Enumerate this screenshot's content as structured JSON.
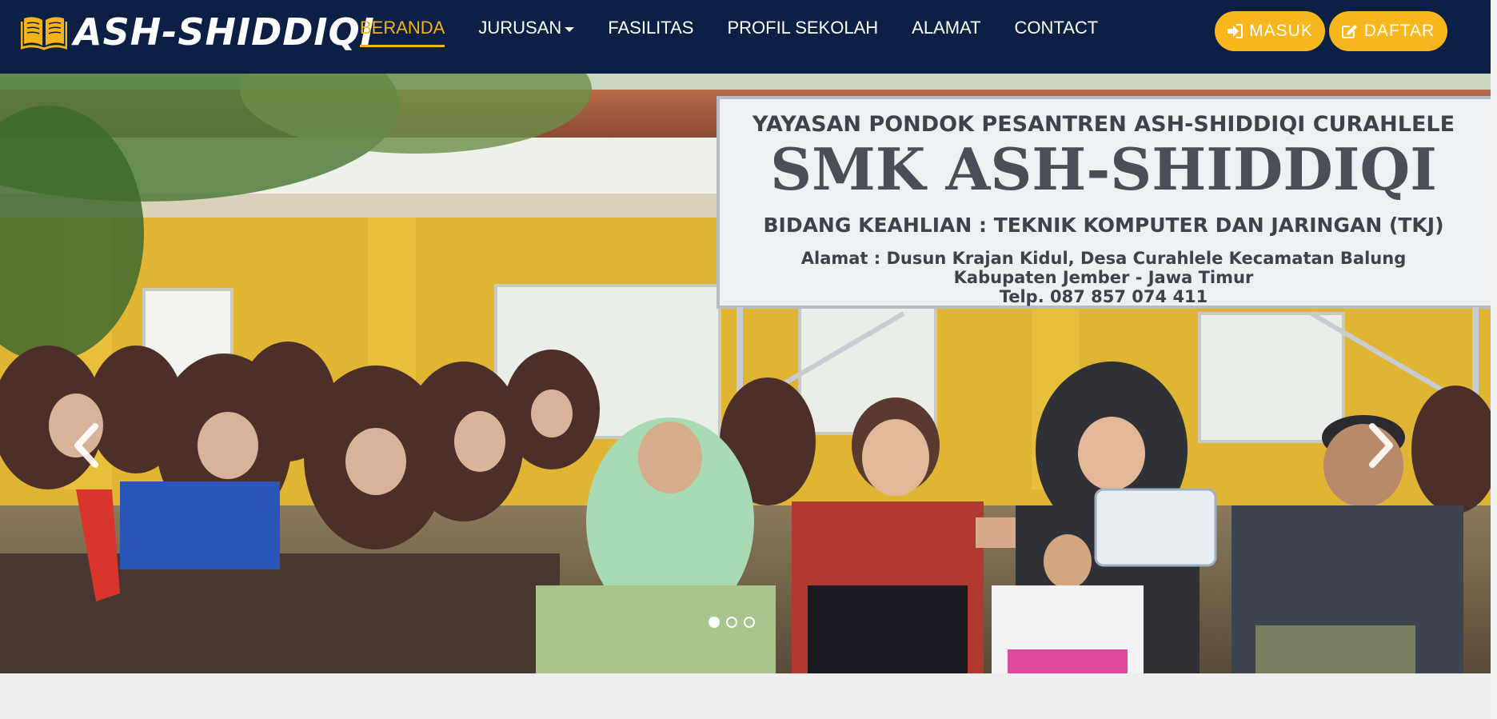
{
  "brand": {
    "name": "ASH-SHIDDIQI",
    "icon": "book-open-icon"
  },
  "nav": {
    "items": [
      {
        "label": "BERANDA",
        "active": true
      },
      {
        "label": "JURUSAN",
        "dropdown": true
      },
      {
        "label": "FASILITAS"
      },
      {
        "label": "PROFIL SEKOLAH"
      },
      {
        "label": "ALAMAT"
      },
      {
        "label": "CONTACT"
      }
    ]
  },
  "actions": {
    "login_label": "MASUK",
    "login_icon": "sign-in-icon",
    "register_label": "DAFTAR",
    "register_icon": "edit-icon"
  },
  "hero": {
    "sign": {
      "line1": "YAYASAN PONDOK PESANTREN ASH-SHIDDIQI CURAHLELE",
      "line2": "SMK ASH-SHIDDIQI",
      "line3": "BIDANG KEAHLIAN : TEKNIK KOMPUTER DAN JARINGAN (TKJ)",
      "line4": "Alamat : Dusun Krajan Kidul, Desa Curahlele Kecamatan Balung",
      "line5": "Kabupaten Jember - Jawa Timur",
      "line6": "Telp. 087 857 074 411"
    },
    "slide_count": 3,
    "active_slide": 1
  },
  "colors": {
    "navbar": "#0c1f45",
    "accent": "#f5b31a",
    "button": "#f7b71d",
    "page_bg": "#eeeeee"
  }
}
